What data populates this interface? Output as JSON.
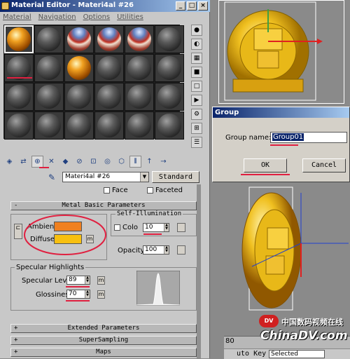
{
  "editor": {
    "title": "Material Editor - Materi4al #26",
    "menu": [
      "Material",
      "Navigation",
      "Options",
      "Utilities"
    ],
    "slots": [
      "gold",
      "gray",
      "flag",
      "flag",
      "flag",
      "gray",
      "gray",
      "gray",
      "gold",
      "gray",
      "gray",
      "gray",
      "gray",
      "gray",
      "gray",
      "gray",
      "gray",
      "gray",
      "gray",
      "gray",
      "gray",
      "gray",
      "gray",
      "gray"
    ],
    "material_name": "Materi4al #26",
    "type_button": "Standard",
    "face_label": "Face",
    "faceted_label": "Faceted",
    "metal_rollout": "Metal Basic Parameters",
    "ambient_label": "Ambient:",
    "diffuse_label": "Diffuse:",
    "ambient_color": "#f08020",
    "diffuse_color": "#f8c010",
    "self_illum_label": "Self-Illumination",
    "color_label": "Colo",
    "self_illum_value": "10",
    "opacity_label": "Opacity:",
    "opacity_value": "100",
    "specular_group": "Specular Highlights",
    "spec_level_label": "Specular Level:",
    "spec_level_value": "89",
    "glossiness_label": "Glossiness:",
    "glossiness_value": "70",
    "map_button": "m",
    "extended_rollout": "Extended Parameters",
    "supersampling_rollout": "SuperSampling",
    "maps_rollout": "Maps"
  },
  "group_dialog": {
    "title": "Group",
    "name_label": "Group name:",
    "name_value": "Group01",
    "ok_label": "OK",
    "cancel_label": "Cancel"
  },
  "status": {
    "frame": "80",
    "autokey": "uto Key",
    "selected": "Selected"
  },
  "watermark": {
    "cn": "中国数码视频在线",
    "en": "ChinaDV.com"
  }
}
